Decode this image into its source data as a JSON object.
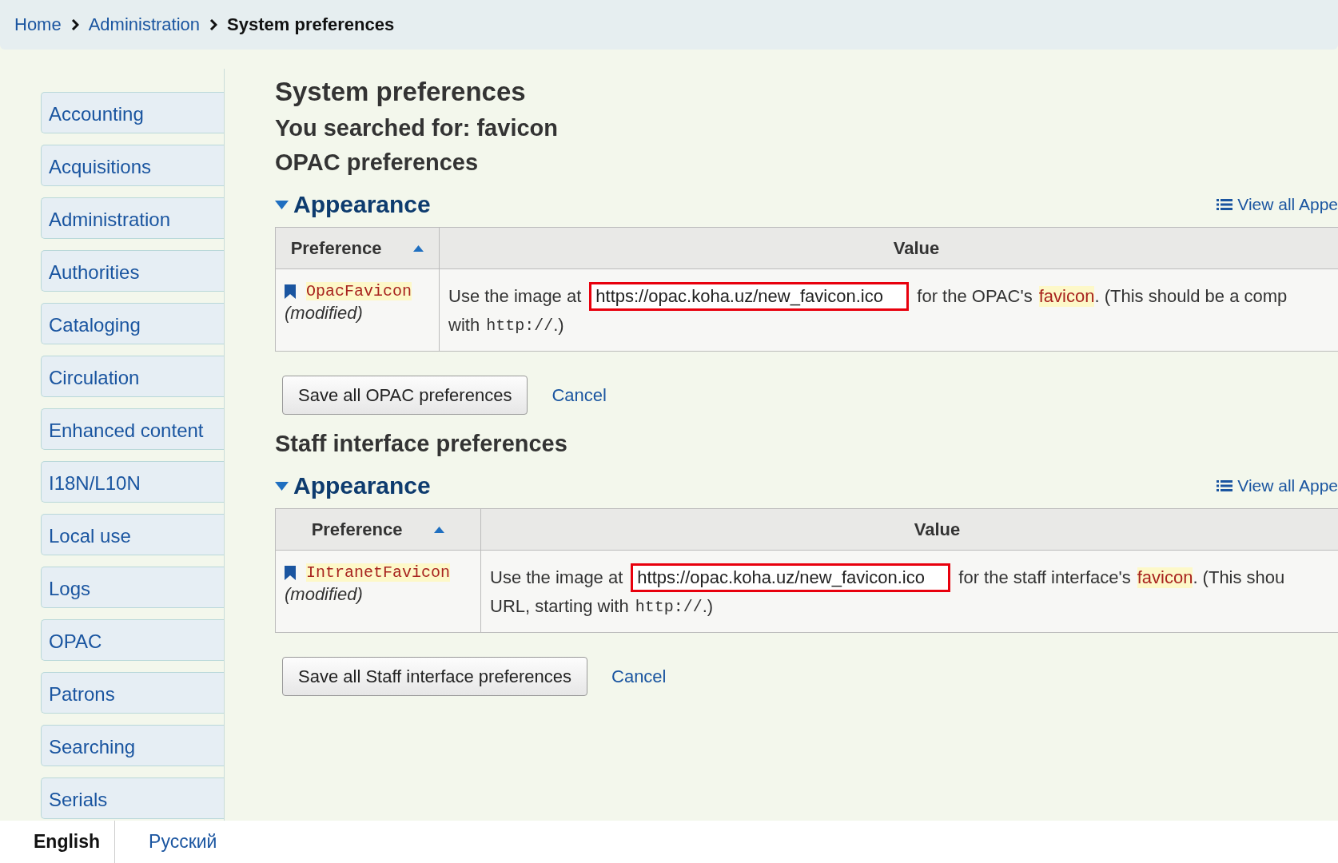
{
  "breadcrumbs": [
    {
      "label": "Home",
      "current": false
    },
    {
      "label": "Administration",
      "current": false
    },
    {
      "label": "System preferences",
      "current": true
    }
  ],
  "sidebar": {
    "items": [
      {
        "label": "Accounting"
      },
      {
        "label": "Acquisitions"
      },
      {
        "label": "Administration"
      },
      {
        "label": "Authorities"
      },
      {
        "label": "Cataloging"
      },
      {
        "label": "Circulation"
      },
      {
        "label": "Enhanced content"
      },
      {
        "label": "I18N/L10N"
      },
      {
        "label": "Local use"
      },
      {
        "label": "Logs"
      },
      {
        "label": "OPAC"
      },
      {
        "label": "Patrons"
      },
      {
        "label": "Searching"
      },
      {
        "label": "Serials"
      }
    ]
  },
  "title": "System preferences",
  "search_summary": "You searched for: favicon",
  "sections": [
    {
      "title": "OPAC preferences",
      "group": {
        "title": "Appearance",
        "expanded": true,
        "view_all": "View all Appe",
        "columns": [
          {
            "label": "Preference",
            "sorted": true
          },
          {
            "label": "Value",
            "sorted": false
          }
        ],
        "rows": [
          {
            "name": "OpacFavicon",
            "status": "(modified)",
            "lines": [
              [
                {
                  "kind": "text",
                  "text": "Use the image at"
                },
                {
                  "kind": "field",
                  "value": "https://opac.koha.uz/new_favicon.ico"
                },
                {
                  "kind": "text",
                  "text": "for the OPAC's"
                },
                {
                  "kind": "highlight",
                  "text": "favicon"
                },
                {
                  "kind": "text",
                  "text": ". (This should be a comp"
                }
              ],
              [
                {
                  "kind": "text",
                  "text": "with"
                },
                {
                  "kind": "code",
                  "text": "http://"
                },
                {
                  "kind": "text",
                  "text": ".)"
                }
              ]
            ]
          }
        ]
      },
      "save_button": "Save all OPAC preferences",
      "cancel": "Cancel"
    },
    {
      "title": "Staff interface preferences",
      "group": {
        "title": "Appearance",
        "expanded": true,
        "view_all": "View all Appe",
        "columns": [
          {
            "label": "Preference",
            "sorted": true
          },
          {
            "label": "Value",
            "sorted": false
          }
        ],
        "rows": [
          {
            "name": "IntranetFavicon",
            "status": "(modified)",
            "lines": [
              [
                {
                  "kind": "text",
                  "text": "Use the image at"
                },
                {
                  "kind": "field",
                  "value": "https://opac.koha.uz/new_favicon.ico"
                },
                {
                  "kind": "text",
                  "text": "for the staff interface's"
                },
                {
                  "kind": "highlight",
                  "text": "favicon"
                },
                {
                  "kind": "text",
                  "text": ". (This shou"
                }
              ],
              [
                {
                  "kind": "text",
                  "text": "URL, starting with"
                },
                {
                  "kind": "code",
                  "text": "http://"
                },
                {
                  "kind": "text",
                  "text": ".)"
                }
              ]
            ]
          }
        ]
      },
      "save_button": "Save all Staff interface preferences",
      "cancel": "Cancel"
    }
  ],
  "languages": [
    {
      "label": "English",
      "selected": true
    },
    {
      "label": "Русский",
      "selected": false
    }
  ]
}
